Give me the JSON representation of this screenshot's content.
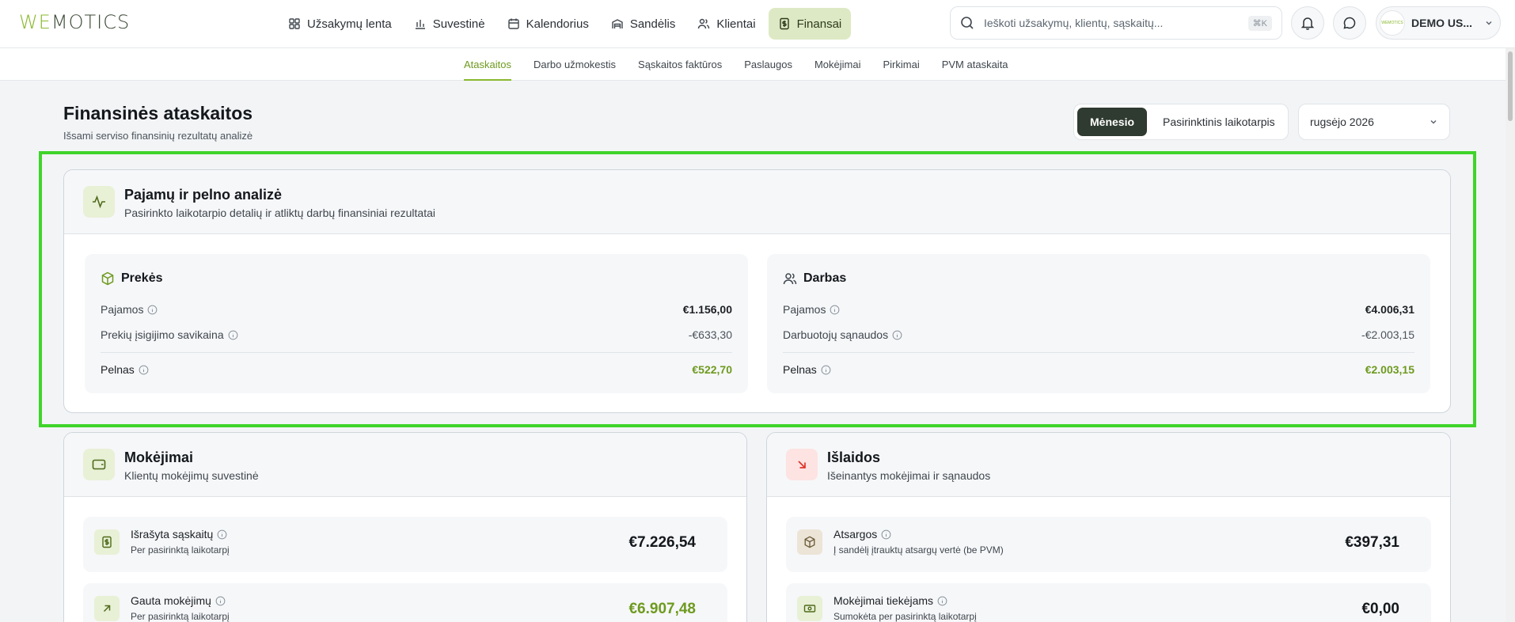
{
  "brand": {
    "logo_we": "WE",
    "logo_rest": "MOTICS",
    "avatar_text": "WEMOTICS"
  },
  "nav": [
    {
      "label": "Užsakymų lenta",
      "icon": "grid-icon"
    },
    {
      "label": "Suvestinė",
      "icon": "bar-chart-icon"
    },
    {
      "label": "Kalendorius",
      "icon": "calendar-icon"
    },
    {
      "label": "Sandėlis",
      "icon": "warehouse-icon"
    },
    {
      "label": "Klientai",
      "icon": "users-icon"
    },
    {
      "label": "Finansai",
      "icon": "receipt-icon",
      "active": true
    }
  ],
  "search": {
    "placeholder": "Ieškoti užsakymų, klientų, sąskaitų...",
    "shortcut": "⌘K"
  },
  "user": {
    "name": "DEMO US..."
  },
  "subnav": [
    "Ataskaitos",
    "Darbo užmokestis",
    "Sąskaitos faktūros",
    "Paslaugos",
    "Mokėjimai",
    "Pirkimai",
    "PVM ataskaita"
  ],
  "page": {
    "title": "Finansinės ataskaitos",
    "subtitle": "Išsami serviso finansinių rezultatų analizė",
    "period_monthly": "Mėnesio",
    "period_custom": "Pasirinktinis laikotarpis",
    "month": "rugsėjo 2026"
  },
  "analysis": {
    "title": "Pajamų ir pelno analizė",
    "subtitle": "Pasirinkto laikotarpio detalių ir atliktų darbų finansiniai rezultatai",
    "goods": {
      "title": "Prekės",
      "revenue_label": "Pajamos",
      "revenue": "€1.156,00",
      "cost_label": "Prekių įsigijimo savikaina",
      "cost": "-€633,30",
      "profit_label": "Pelnas",
      "profit": "€522,70"
    },
    "labor": {
      "title": "Darbas",
      "revenue_label": "Pajamos",
      "revenue": "€4.006,31",
      "cost_label": "Darbuotojų sąnaudos",
      "cost": "-€2.003,15",
      "profit_label": "Pelnas",
      "profit": "€2.003,15"
    }
  },
  "payments": {
    "title": "Mokėjimai",
    "subtitle": "Klientų mokėjimų suvestinė",
    "items": [
      {
        "title": "Išrašyta sąskaitų",
        "sub": "Per pasirinktą laikotarpį",
        "value": "€7.226,54"
      },
      {
        "title": "Gauta mokėjimų",
        "sub": "Per pasirinktą laikotarpį",
        "value": "€6.907,48"
      }
    ]
  },
  "expenses": {
    "title": "Išlaidos",
    "subtitle": "Išeinantys mokėjimai ir sąnaudos",
    "items": [
      {
        "title": "Atsargos",
        "sub": "Į sandėlį įtrauktų atsargų vertė (be PVM)",
        "value": "€397,31"
      },
      {
        "title": "Mokėjimai tiekėjams",
        "sub": "Sumokėta per pasirinktą laikotarpį",
        "value": "€0,00"
      }
    ]
  },
  "colors": {
    "accent": "#8ab82e",
    "accent_dark": "#6e9a1f",
    "highlight": "#3fd42a",
    "danger": "#e0342b"
  }
}
